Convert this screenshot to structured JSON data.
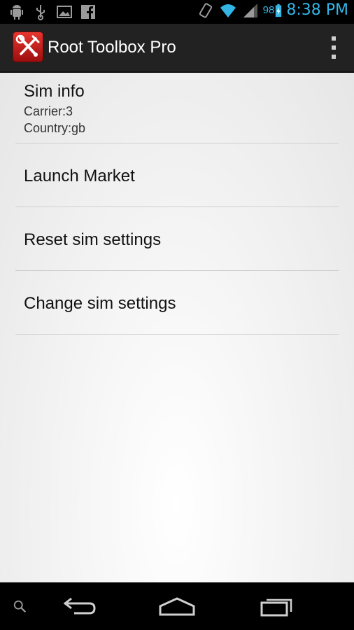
{
  "status_bar": {
    "left_icons": [
      "android-debug-icon",
      "usb-icon",
      "image-icon",
      "facebook-icon"
    ],
    "right_icons": [
      "vibrate-icon",
      "wifi-icon",
      "signal-icon",
      "battery-charging-icon"
    ],
    "battery_percent": "98",
    "time": "8:38 PM"
  },
  "action_bar": {
    "title": "Root Toolbox Pro"
  },
  "list": {
    "sim_info": {
      "title": "Sim info",
      "carrier": "Carrier:3",
      "country": "Country:gb"
    },
    "launch_market": "Launch Market",
    "reset_sim": "Reset sim settings",
    "change_sim": "Change sim settings"
  },
  "colors": {
    "accent": "#33b5e5",
    "action_bar": "#222222",
    "app_icon": "#d32320"
  }
}
